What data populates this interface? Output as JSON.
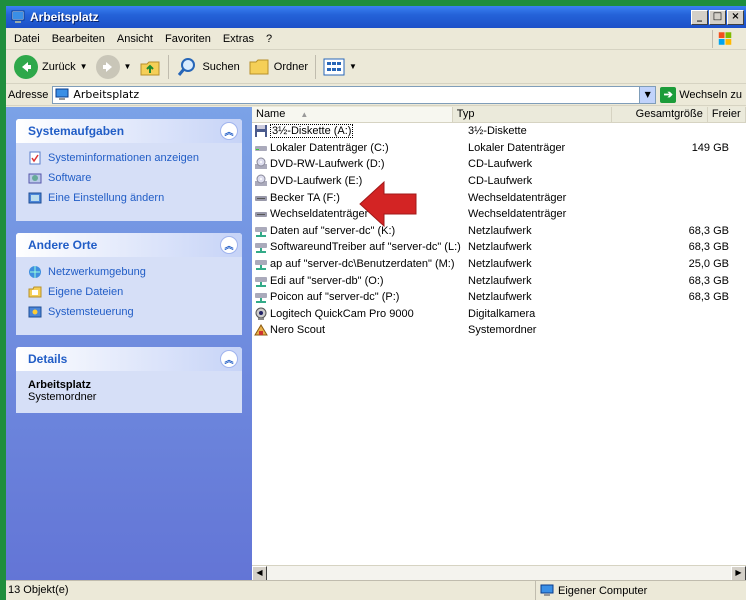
{
  "window": {
    "title": "Arbeitsplatz",
    "accent": "#2462d8",
    "frame_color": "#1f8e3d"
  },
  "menu": {
    "items": [
      "Datei",
      "Bearbeiten",
      "Ansicht",
      "Favoriten",
      "Extras",
      "?"
    ]
  },
  "toolbar": {
    "back_label": "Zurück",
    "search_label": "Suchen",
    "folders_label": "Ordner"
  },
  "address": {
    "label": "Adresse",
    "value": "Arbeitsplatz",
    "go_label": "Wechseln zu"
  },
  "taskpane": {
    "system_tasks": {
      "title": "Systemaufgaben",
      "items": [
        {
          "label": "Systeminformationen anzeigen",
          "icon": "system-info-icon"
        },
        {
          "label": "Software",
          "icon": "software-icon"
        },
        {
          "label": "Eine Einstellung ändern",
          "icon": "settings-icon"
        }
      ]
    },
    "other_places": {
      "title": "Andere Orte",
      "items": [
        {
          "label": "Netzwerkumgebung",
          "icon": "network-icon"
        },
        {
          "label": "Eigene Dateien",
          "icon": "my-documents-icon"
        },
        {
          "label": "Systemsteuerung",
          "icon": "control-panel-icon"
        }
      ]
    },
    "details": {
      "title": "Details",
      "name": "Arbeitsplatz",
      "type": "Systemordner"
    }
  },
  "filelist": {
    "columns": [
      "Name",
      "Typ",
      "Gesamtgröße",
      "Freier"
    ],
    "rows": [
      {
        "name": "3½-Diskette (A:)",
        "type": "3½-Diskette",
        "size": "",
        "icon": "floppy-icon"
      },
      {
        "name": "Lokaler Datenträger (C:)",
        "type": "Lokaler Datenträger",
        "size": "149 GB",
        "icon": "harddisk-icon"
      },
      {
        "name": "DVD-RW-Laufwerk (D:)",
        "type": "CD-Laufwerk",
        "size": "",
        "icon": "cd-drive-icon"
      },
      {
        "name": "DVD-Laufwerk (E:)",
        "type": "CD-Laufwerk",
        "size": "",
        "icon": "cd-drive-icon"
      },
      {
        "name": "Becker TA (F:)",
        "type": "Wechseldatenträger",
        "size": "",
        "icon": "removable-drive-icon"
      },
      {
        "name": "Wechseldatenträger",
        "type": "Wechseldatenträger",
        "size": "",
        "icon": "removable-drive-icon"
      },
      {
        "name": "Daten auf \"server-dc\" (K:)",
        "type": "Netzlaufwerk",
        "size": "68,3 GB",
        "icon": "network-drive-icon"
      },
      {
        "name": "SoftwareundTreiber auf \"server-dc\" (L:)",
        "type": "Netzlaufwerk",
        "size": "68,3 GB",
        "icon": "network-drive-icon"
      },
      {
        "name": "ap auf \"server-dc\\Benutzerdaten\" (M:)",
        "type": "Netzlaufwerk",
        "size": "25,0 GB",
        "icon": "network-drive-icon"
      },
      {
        "name": "Edi auf \"server-db\" (O:)",
        "type": "Netzlaufwerk",
        "size": "68,3 GB",
        "icon": "network-drive-icon"
      },
      {
        "name": "Poicon auf \"server-dc\" (P:)",
        "type": "Netzlaufwerk",
        "size": "68,3 GB",
        "icon": "network-drive-icon"
      },
      {
        "name": "Logitech QuickCam Pro 9000",
        "type": "Digitalkamera",
        "size": "",
        "icon": "webcam-icon"
      },
      {
        "name": "Nero Scout",
        "type": "Systemordner",
        "size": "",
        "icon": "nero-scout-icon"
      }
    ]
  },
  "status": {
    "count": "13 Objekt(e)",
    "zone": "Eigener Computer"
  }
}
